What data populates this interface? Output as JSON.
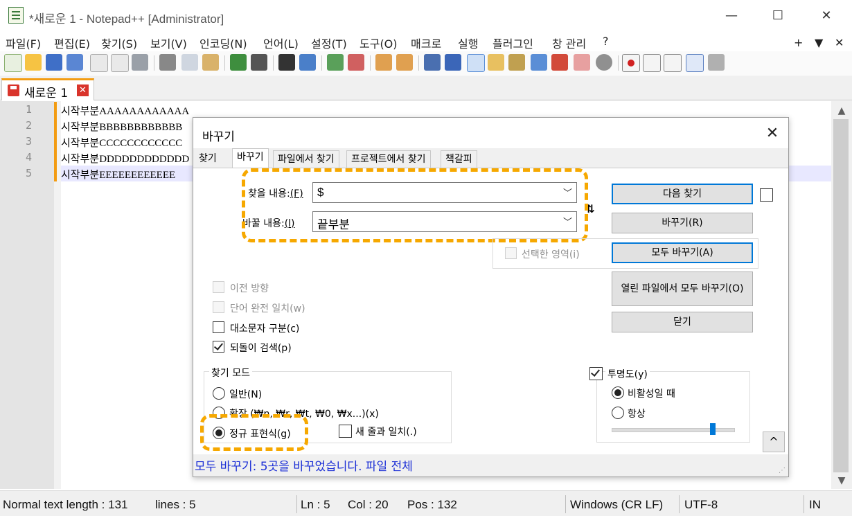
{
  "window": {
    "title": "*새로운 1 - Notepad++ [Administrator]",
    "controls": {
      "minimize": "—",
      "maximize": "☐",
      "close": "✕"
    }
  },
  "menu": {
    "items": [
      "파일(F)",
      "편집(E)",
      "찾기(S)",
      "보기(V)",
      "인코딩(N)",
      "언어(L)",
      "설정(T)",
      "도구(O)",
      "매크로",
      "실행",
      "플러그인",
      "창 관리",
      "?"
    ],
    "right": [
      "+",
      "▼",
      "✕"
    ]
  },
  "tab": {
    "label": "새로운 1",
    "close": "✕"
  },
  "editor": {
    "lines": [
      {
        "num": "1",
        "text": "시작부분AAAAAAAAAAAA"
      },
      {
        "num": "2",
        "text": "시작부분BBBBBBBBBBBB"
      },
      {
        "num": "3",
        "text": "시작부분CCCCCCCCCCCC"
      },
      {
        "num": "4",
        "text": "시작부분DDDDDDDDDDDD"
      },
      {
        "num": "5",
        "text": "시작부분EEEEEEEEEEEE"
      }
    ]
  },
  "statusbar": {
    "length": "Normal text length : 131",
    "lines": "lines : 5",
    "ln": "Ln : 5",
    "col": "Col : 20",
    "pos": "Pos : 132",
    "eol": "Windows (CR LF)",
    "encoding": "UTF-8",
    "mode": "IN"
  },
  "dialog": {
    "title": "바꾸기",
    "close": "✕",
    "tabs": [
      "찾기",
      "바꾸기",
      "파일에서 찾기",
      "프로젝트에서 찾기",
      "책갈피"
    ],
    "find_label": "찾을 내용:",
    "find_key": "(F)",
    "find_value": "$",
    "replace_label": "바꿀 내용:",
    "replace_key": "(l)",
    "replace_value": "끝부분",
    "swap": "⇅",
    "buttons": {
      "find_next": "다음 찾기",
      "replace": "바꾸기(R)",
      "replace_all": "모두 바꾸기(A)",
      "replace_all_open": "열린 파일에서 모두 바꾸기(O)",
      "close": "닫기"
    },
    "in_selection": "선택한 영역(i)",
    "options": {
      "backward": "이전 방향",
      "whole_word": "단어 완전 일치(w)",
      "match_case": "대소문자 구분(c)",
      "wrap": "되돌이 검색(p)"
    },
    "search_mode": {
      "title": "찾기 모드",
      "normal": "일반(N)",
      "extended": "확장 (₩n, ₩r, ₩t, ₩0, ₩x...)(x)",
      "regex": "정규 표현식(g)",
      "dot_newline": "새 줄과 일치(.)"
    },
    "transparency": {
      "title": "투명도(y)",
      "on_losing_focus": "비활성일 때",
      "always": "항상",
      "level": 0.82
    },
    "collapse": "^",
    "status": "모두 바꾸기: 5곳을 바꾸었습니다. 파일 전체"
  },
  "colors": {
    "accent": "#f6a800",
    "status_text": "#1c2fd6",
    "default_button": "#0078d7"
  }
}
